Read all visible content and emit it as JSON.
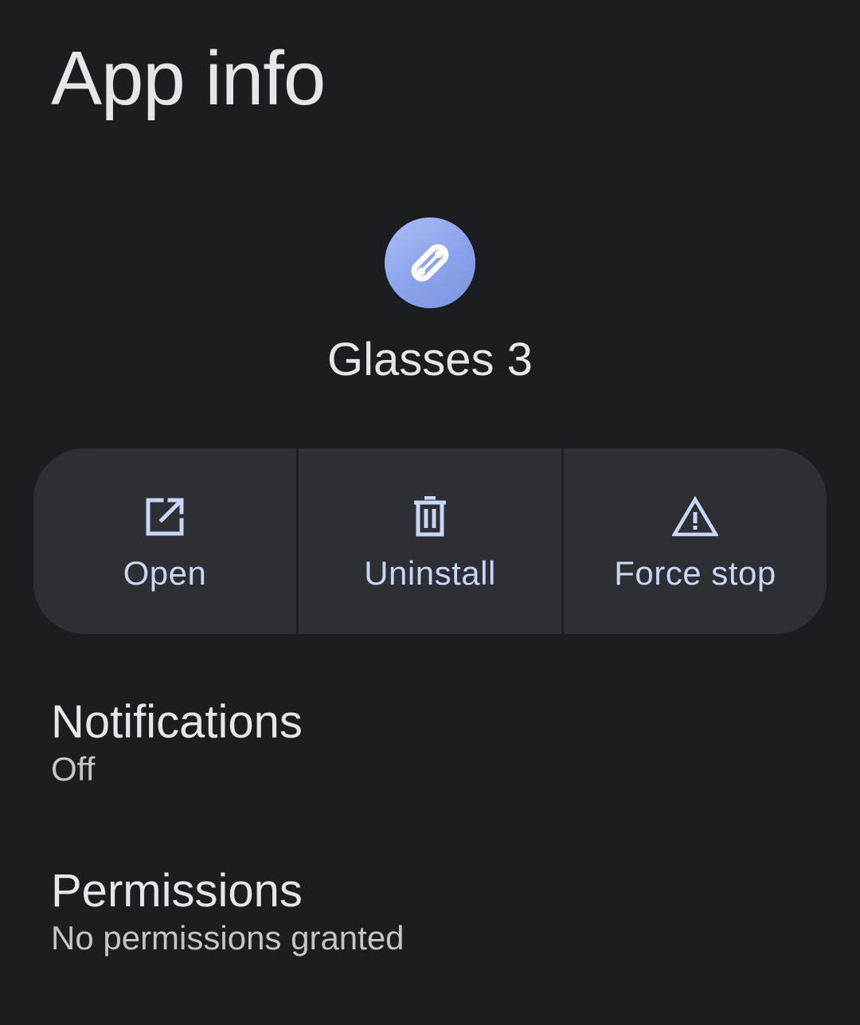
{
  "header": {
    "title": "App info"
  },
  "app": {
    "name": "Glasses 3",
    "icon": "link-icon"
  },
  "actions": [
    {
      "label": "Open",
      "icon": "open-in-new-icon"
    },
    {
      "label": "Uninstall",
      "icon": "trash-icon"
    },
    {
      "label": "Force stop",
      "icon": "warning-icon"
    }
  ],
  "settings": [
    {
      "title": "Notifications",
      "summary": "Off"
    },
    {
      "title": "Permissions",
      "summary": "No permissions granted"
    }
  ],
  "colors": {
    "background": "#1c1d21",
    "surface": "#2e2f35",
    "accent": "#c8d6f7",
    "app_icon": "#8ba3ea"
  }
}
